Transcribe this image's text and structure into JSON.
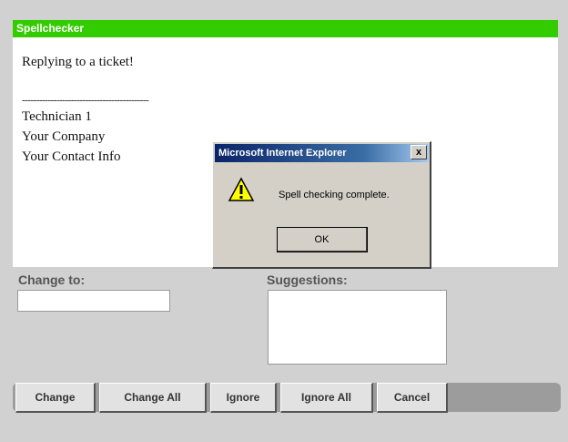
{
  "window": {
    "title": "Spellchecker"
  },
  "document": {
    "line1": "Replying to a ticket!",
    "separator": "--------------------------------------------",
    "signature": [
      "Technician 1",
      "Your Company",
      "Your Contact Info"
    ]
  },
  "fields": {
    "change_to_label": "Change to:",
    "change_to_value": "",
    "suggestions_label": "Suggestions:"
  },
  "buttons": {
    "change": "Change",
    "change_all": "Change All",
    "ignore": "Ignore",
    "ignore_all": "Ignore All",
    "cancel": "Cancel"
  },
  "dialog": {
    "title": "Microsoft Internet Explorer",
    "close": "x",
    "message": "Spell checking complete.",
    "ok": "OK",
    "icon": "warning-icon"
  },
  "colors": {
    "title_bar": "#33cc00",
    "background": "#d1d1d1"
  }
}
